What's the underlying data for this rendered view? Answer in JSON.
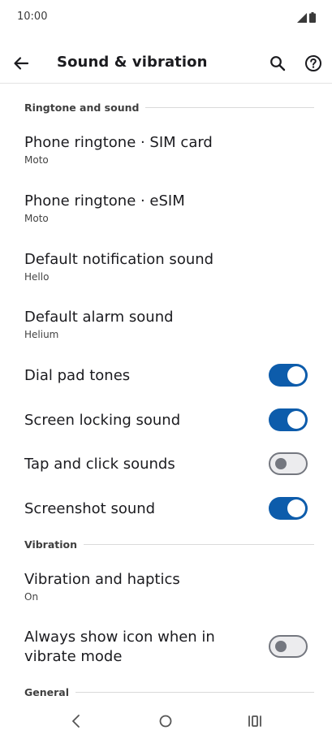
{
  "status_bar": {
    "time": "10:00"
  },
  "app_bar": {
    "title": "Sound & vibration"
  },
  "sections": {
    "ringtone": "Ringtone and sound",
    "vibration": "Vibration",
    "general": "General"
  },
  "prefs": {
    "sim_ringtone": {
      "title": "Phone ringtone · SIM card",
      "summary": "Moto"
    },
    "esim_ringtone": {
      "title": "Phone ringtone · eSIM",
      "summary": "Moto"
    },
    "notification_sound": {
      "title": "Default notification sound",
      "summary": "Hello"
    },
    "alarm_sound": {
      "title": "Default alarm sound",
      "summary": "Helium"
    },
    "dial_pad_tones": {
      "title": "Dial pad tones",
      "state": "on"
    },
    "screen_locking_sound": {
      "title": "Screen locking sound",
      "state": "on"
    },
    "tap_click_sounds": {
      "title": "Tap and click sounds",
      "state": "off"
    },
    "screenshot_sound": {
      "title": "Screenshot sound",
      "state": "on"
    },
    "vibration_haptics": {
      "title": "Vibration and haptics",
      "summary": "On"
    },
    "vibrate_icon": {
      "title_line1": "Always show icon when in",
      "title_line2": "vibrate mode",
      "state": "off"
    }
  },
  "colors": {
    "accent": "#0d5cab",
    "switch_off_outline": "#74777f"
  },
  "icons": [
    "signal-icon",
    "battery-icon",
    "back-arrow-icon",
    "search-icon",
    "help-icon",
    "nav-back-icon",
    "nav-home-icon",
    "nav-recents-icon"
  ]
}
